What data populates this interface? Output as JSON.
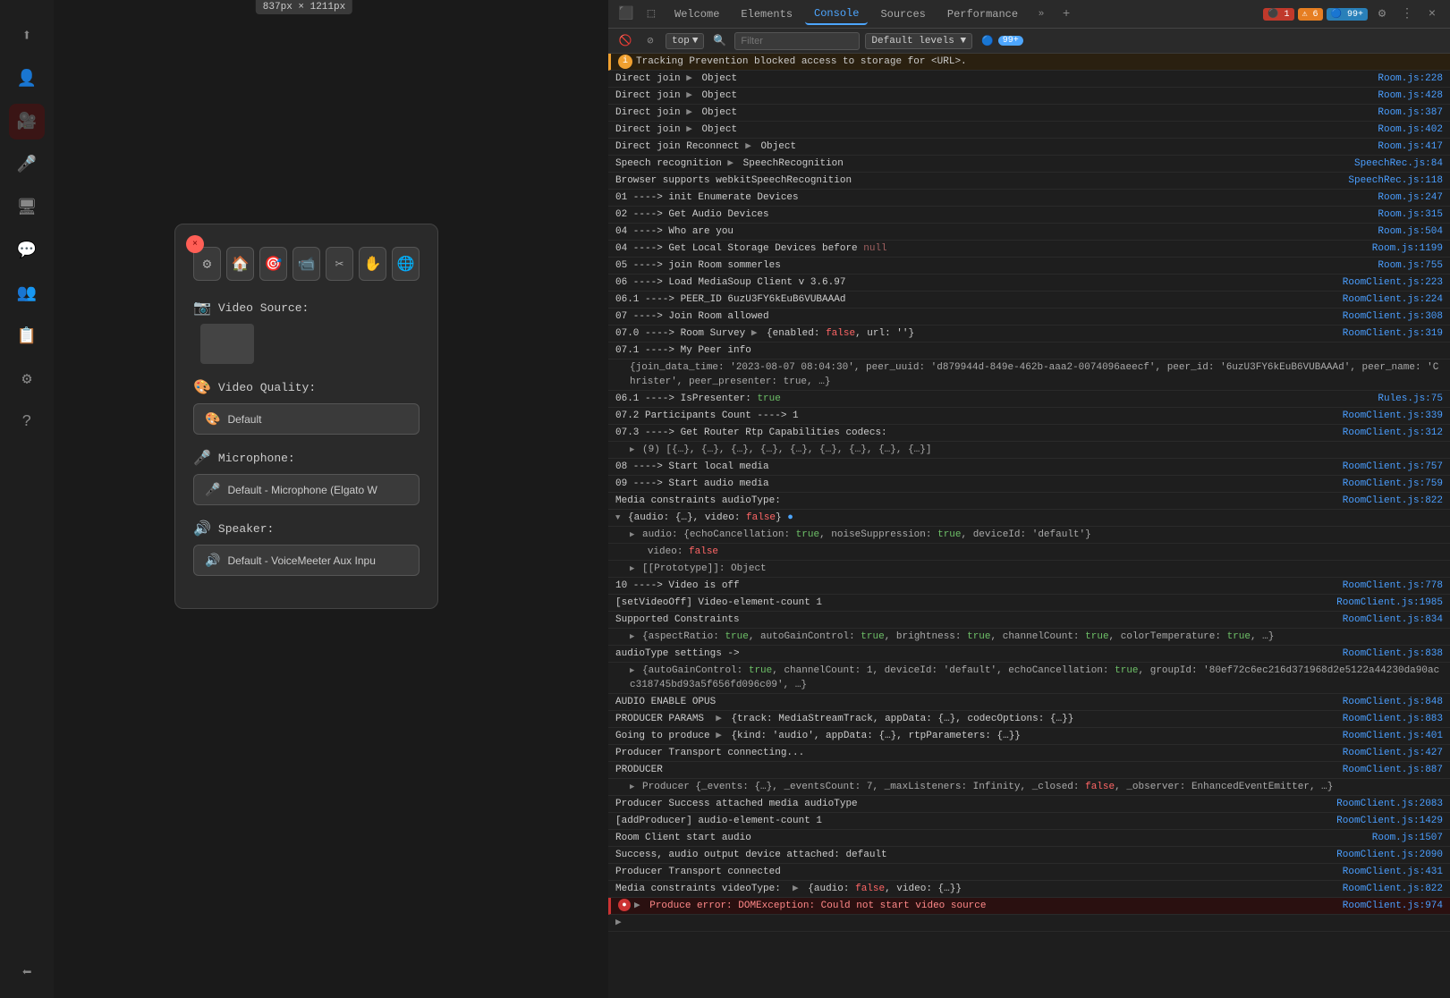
{
  "dimension": "837px × 1211px",
  "app": {
    "sidebar_icons": [
      {
        "name": "share-icon",
        "symbol": "⎋",
        "active": false
      },
      {
        "name": "user-icon",
        "symbol": "👤",
        "active": false
      },
      {
        "name": "video-off-icon",
        "symbol": "📵",
        "active": true,
        "red": true
      },
      {
        "name": "mic-off-icon",
        "symbol": "🎤",
        "active": false
      },
      {
        "name": "screen-share-icon",
        "symbol": "🖥",
        "active": false
      },
      {
        "name": "chat-icon",
        "symbol": "💬",
        "active": false
      },
      {
        "name": "participants-icon",
        "symbol": "👥",
        "active": false
      },
      {
        "name": "whiteboard-icon",
        "symbol": "📋",
        "active": false
      },
      {
        "name": "settings-icon",
        "symbol": "⚙",
        "active": false
      },
      {
        "name": "help-icon",
        "symbol": "?",
        "active": false
      },
      {
        "name": "leave-icon",
        "symbol": "⬅",
        "active": false,
        "bottom": true
      }
    ]
  },
  "dialog": {
    "title": "Settings",
    "close_label": "×",
    "toolbar_buttons": [
      {
        "name": "gear-btn",
        "symbol": "⚙"
      },
      {
        "name": "home-btn",
        "symbol": "🏠"
      },
      {
        "name": "camera-btn",
        "symbol": "📷"
      },
      {
        "name": "video-btn",
        "symbol": "📹"
      },
      {
        "name": "scissors-btn",
        "symbol": "✂"
      },
      {
        "name": "hand-btn",
        "symbol": "✋"
      },
      {
        "name": "globe-btn",
        "symbol": "🌐"
      }
    ],
    "video_source_label": "Video Source:",
    "video_quality_label": "Video Quality:",
    "video_quality_value": "Default",
    "microphone_label": "Microphone:",
    "microphone_value": "Default - Microphone (Elgato W",
    "speaker_label": "Speaker:",
    "speaker_value": "Default - VoiceMeeter Aux Inpu"
  },
  "devtools": {
    "tabs": [
      {
        "label": "Welcome",
        "active": false
      },
      {
        "label": "Elements",
        "active": false
      },
      {
        "label": "Console",
        "active": true
      },
      {
        "label": "Sources",
        "active": false
      },
      {
        "label": "Performance",
        "active": false
      }
    ],
    "badges": {
      "errors": "1",
      "warnings": "6",
      "info": "99+"
    },
    "console_filter_placeholder": "Filter",
    "levels_label": "Default levels",
    "top_label": "top",
    "count_label": "99+",
    "console_lines": [
      {
        "type": "tracking",
        "content": "Tracking Prevention blocked access to storage for <URL>.",
        "location": ""
      },
      {
        "type": "log",
        "content": "Direct join ▶ Object",
        "location": "Room.js:228"
      },
      {
        "type": "log",
        "content": "Direct join ▶ Object",
        "location": "Room.js:428"
      },
      {
        "type": "log",
        "content": "Direct join ▶ Object",
        "location": "Room.js:387"
      },
      {
        "type": "log",
        "content": "Direct join ▶ Object",
        "location": "Room.js:402"
      },
      {
        "type": "log",
        "content": "Direct join Reconnect ▶ Object",
        "location": "Room.js:417"
      },
      {
        "type": "log",
        "content": "Speech recognition ▶ SpeechRecognition",
        "location": "SpeechRec.js:84"
      },
      {
        "type": "log",
        "content": "Browser supports webkitSpeechRecognition",
        "location": "SpeechRec.js:118"
      },
      {
        "type": "log",
        "content": "01 ----> init Enumerate Devices",
        "location": "Room.js:247"
      },
      {
        "type": "log",
        "content": "02 ----> Get Audio Devices",
        "location": "Room.js:315"
      },
      {
        "type": "log",
        "content": "04 ----> Who are you",
        "location": "Room.js:504"
      },
      {
        "type": "log",
        "content": "04 ----> Get Local Storage Devices before null",
        "location": "Room.js:1199"
      },
      {
        "type": "log",
        "content": "05 ----> join Room sommerles",
        "location": "Room.js:755"
      },
      {
        "type": "log",
        "content": "06 ----> Load MediaSoup Client v 3.6.97",
        "location": "RoomClient.js:223"
      },
      {
        "type": "log",
        "content": "06.1 ----> PEER_ID 6uzU3FY6kEuB6VUBAAAd",
        "location": "RoomClient.js:224"
      },
      {
        "type": "log",
        "content": "07 ----> Join Room allowed",
        "location": "RoomClient.js:308"
      },
      {
        "type": "log",
        "content": "07.0 ----> Room Survey ▶ {enabled: false, url: ''}",
        "location": "RoomClient.js:319"
      },
      {
        "type": "log-expand",
        "content": "07.1 ----> My Peer info",
        "location": ""
      },
      {
        "type": "log-expand-data",
        "content": "{join_data_time: '2023-08-07 08:04:30', peer_uuid: 'd879944d-849e-462b-aaa2-0074096aeecf', peer_id: '6uzU3FY6kEuB6VUBAAAd', peer_name: 'Christer', peer_presenter: true, …}",
        "location": ""
      },
      {
        "type": "log",
        "content": "06.1 ----> IsPresenter: true",
        "location": "Rules.js:75"
      },
      {
        "type": "log",
        "content": "07.2 Participants Count ----> 1",
        "location": "RoomClient.js:339"
      },
      {
        "type": "log",
        "content": "07.3 ----> Get Router Rtp Capabilities codecs:",
        "location": "RoomClient.js:312"
      },
      {
        "type": "log-expand-data",
        "content": "▶ (9) [{…}, {…}, {…}, {…}, {…}, {…}, {…}, {…}, {…}]",
        "location": ""
      },
      {
        "type": "log",
        "content": "08 ----> Start local media",
        "location": "RoomClient.js:757"
      },
      {
        "type": "log",
        "content": "09 ----> Start audio media",
        "location": "RoomClient.js:759"
      },
      {
        "type": "log",
        "content": "Media constraints audioType:",
        "location": "RoomClient.js:822"
      },
      {
        "type": "log-expand",
        "content": "▼ {audio: {…}, video: false} 🔵",
        "location": ""
      },
      {
        "type": "log-expand-data",
        "content": "▶ audio: {echoCancellation: true, noiseSuppression: true, deviceId: 'default'}",
        "location": ""
      },
      {
        "type": "log-expand-data",
        "content": "   video: false",
        "location": ""
      },
      {
        "type": "log-expand-data",
        "content": "▶ [[Prototype]]: Object",
        "location": ""
      },
      {
        "type": "log",
        "content": "10 ----> Video is off",
        "location": "RoomClient.js:778"
      },
      {
        "type": "log",
        "content": "[setVideoOff] Video-element-count 1",
        "location": "RoomClient.js:1985"
      },
      {
        "type": "log",
        "content": "Supported Constraints",
        "location": "RoomClient.js:834"
      },
      {
        "type": "log-expand-data",
        "content": "▶ {aspectRatio: true, autoGainControl: true, brightness: true, channelCount: true, colorTemperature: true, …}",
        "location": ""
      },
      {
        "type": "log",
        "content": "audioType settings ->",
        "location": "RoomClient.js:838"
      },
      {
        "type": "log-expand-data",
        "content": "▶ {autoGainControl: true, channelCount: 1, deviceId: 'default', echoCancellation: true, groupId: '80ef72c6ec216d371968d2e5122a44230da90acc318745bd93a5f656fd096c09', …}",
        "location": ""
      },
      {
        "type": "log",
        "content": "AUDIO ENABLE OPUS",
        "location": "RoomClient.js:848"
      },
      {
        "type": "log",
        "content": "PRODUCER PARAMS  ▶ {track: MediaStreamTrack, appData: {…}, codecOptions: {…}}",
        "location": "RoomClient.js:883"
      },
      {
        "type": "log",
        "content": "Going to produce ▶ {kind: 'audio', appData: {…}, rtpParameters: {…}}",
        "location": "RoomClient.js:401"
      },
      {
        "type": "log",
        "content": "Producer Transport connecting...",
        "location": "RoomClient.js:427"
      },
      {
        "type": "log",
        "content": "PRODUCER",
        "location": "RoomClient.js:887"
      },
      {
        "type": "log-expand-data",
        "content": "▶ Producer {_events: {…}, _eventsCount: 7, _maxListeners: Infinity, _closed: false, _observer: EnhancedEventEmitter, …}",
        "location": ""
      },
      {
        "type": "log",
        "content": "Producer Success attached media audioType",
        "location": "RoomClient.js:2083"
      },
      {
        "type": "log",
        "content": "[addProducer] audio-element-count 1",
        "location": "RoomClient.js:1429"
      },
      {
        "type": "log",
        "content": "Room Client start audio",
        "location": "Room.js:1507"
      },
      {
        "type": "log",
        "content": "Success, audio output device attached: default",
        "location": "RoomClient.js:2090"
      },
      {
        "type": "log",
        "content": "Producer Transport connected",
        "location": "RoomClient.js:431"
      },
      {
        "type": "log",
        "content": "Media constraints videoType:  ▶ {audio: false, video: {…}}",
        "location": "RoomClient.js:822"
      },
      {
        "type": "error",
        "content": "▶ Produce error: DOMException: Could not start video source",
        "location": "RoomClient.js:974"
      },
      {
        "type": "log",
        "content": "▶",
        "location": ""
      }
    ]
  }
}
